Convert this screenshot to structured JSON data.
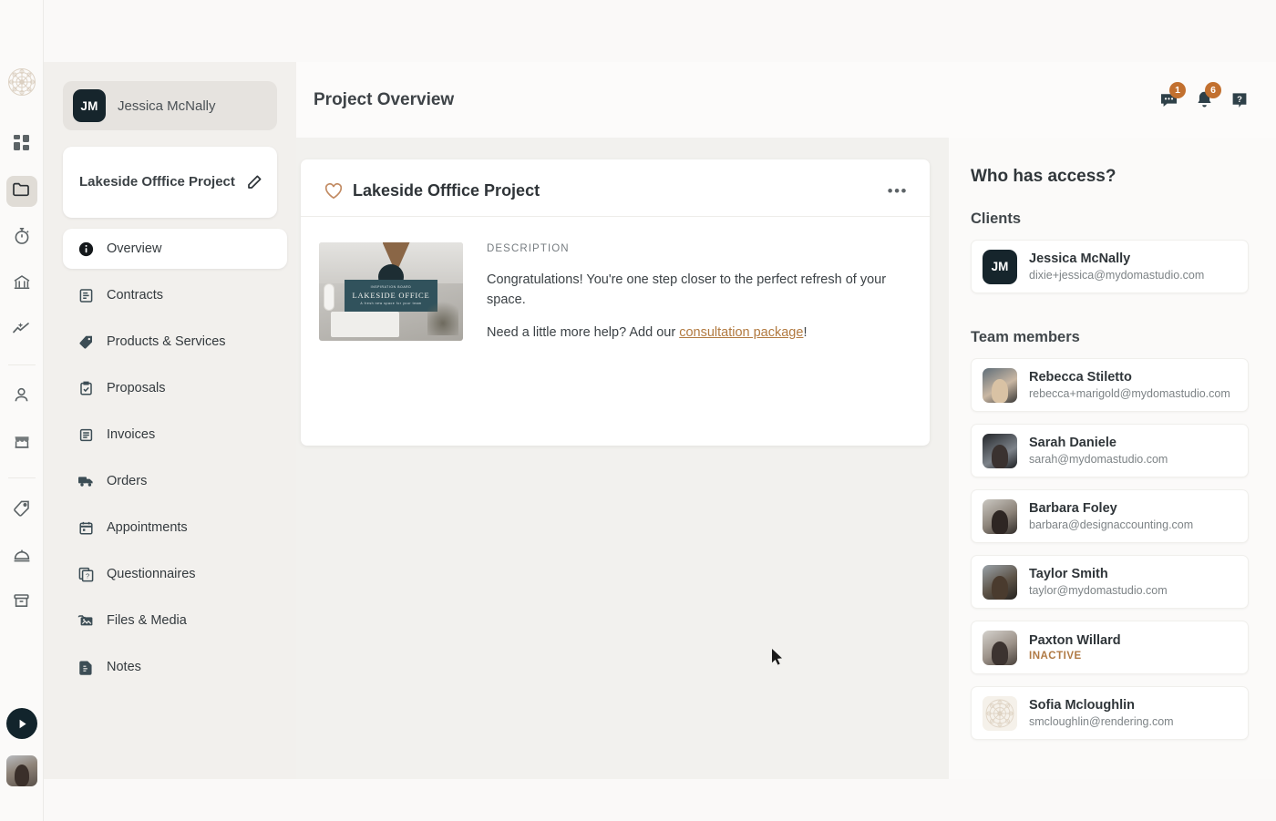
{
  "rail": {
    "logo_icon": "mandala-logo-icon",
    "items": [
      {
        "name": "dashboard",
        "icon": "grid-icon",
        "active": false
      },
      {
        "name": "projects",
        "icon": "folder-icon",
        "active": true
      },
      {
        "name": "time-tracking",
        "icon": "stopwatch-icon",
        "active": false
      },
      {
        "name": "bank",
        "icon": "bank-icon",
        "active": false
      },
      {
        "name": "reports",
        "icon": "chart-line-icon",
        "active": false
      },
      {
        "name": "contacts",
        "icon": "person-icon",
        "active": false
      },
      {
        "name": "storefront",
        "icon": "storefront-icon",
        "active": false
      },
      {
        "name": "pricing",
        "icon": "tag-icon",
        "active": false
      },
      {
        "name": "services",
        "icon": "service-bell-icon",
        "active": false
      },
      {
        "name": "archive",
        "icon": "archive-box-icon",
        "active": false
      }
    ],
    "play_icon": "play-button-icon",
    "avatar_icon": "user-avatar"
  },
  "sidebar": {
    "user": {
      "initials": "JM",
      "name": "Jessica McNally"
    },
    "project": {
      "title": "Lakeside Offfice Project",
      "edit_icon": "pencil-icon"
    },
    "nav": [
      {
        "label": "Overview",
        "icon": "info-circle-icon",
        "active": true
      },
      {
        "label": "Contracts",
        "icon": "contract-icon",
        "active": false
      },
      {
        "label": "Products & Services",
        "icon": "tag-icon",
        "active": false
      },
      {
        "label": "Proposals",
        "icon": "clipboard-check-icon",
        "active": false
      },
      {
        "label": "Invoices",
        "icon": "invoice-icon",
        "active": false
      },
      {
        "label": "Orders",
        "icon": "truck-icon",
        "active": false
      },
      {
        "label": "Appointments",
        "icon": "calendar-icon",
        "active": false
      },
      {
        "label": "Questionnaires",
        "icon": "question-doc-icon",
        "active": false
      },
      {
        "label": "Files & Media",
        "icon": "photo-folder-icon",
        "active": false
      },
      {
        "label": "Notes",
        "icon": "note-icon",
        "active": false
      }
    ]
  },
  "header": {
    "title": "Project Overview",
    "icons": [
      {
        "name": "messages-icon",
        "badge": "1"
      },
      {
        "name": "notifications-bell-icon",
        "badge": "6"
      },
      {
        "name": "help-question-icon",
        "badge": ""
      }
    ],
    "badge_color": "#c2702f"
  },
  "card": {
    "favorite_icon": "heart-outline-icon",
    "title": "Lakeside Offfice Project",
    "menu_icon": "ellipsis-icon",
    "menu_label": "•••",
    "description_label": "DESCRIPTION",
    "thumbnail": {
      "overline": "INSPIRATION BOARD",
      "headline": "LAKESIDE OFFICE",
      "subline": "A fresh new space for your team"
    },
    "paragraph1": "Congratulations! You're one step closer to the perfect refresh of your space.",
    "paragraph2_before": "Need a little more help? Add our ",
    "paragraph2_link": "consultation package",
    "paragraph2_after": "!",
    "link_color": "#b1793f"
  },
  "access": {
    "heading": "Who has access?",
    "clients_heading": "Clients",
    "clients": [
      {
        "initials": "JM",
        "name": "Jessica McNally",
        "email": "dixie+jessica@mydomastudio.com",
        "avatar": "initials"
      }
    ],
    "team_heading": "Team members",
    "team": [
      {
        "name": "Rebecca Stiletto",
        "email": "rebecca+marigold@mydomastudio.com",
        "avatar": "photo-rebecca",
        "inactive": false
      },
      {
        "name": "Sarah Daniele",
        "email": "sarah@mydomastudio.com",
        "avatar": "photo-sarah",
        "inactive": false
      },
      {
        "name": "Barbara Foley",
        "email": "barbara@designaccounting.com",
        "avatar": "photo-barbara",
        "inactive": false
      },
      {
        "name": "Taylor Smith",
        "email": "taylor@mydomastudio.com",
        "avatar": "photo-taylor",
        "inactive": false
      },
      {
        "name": "Paxton Willard",
        "email": "INACTIVE",
        "avatar": "photo-paxton",
        "inactive": true
      },
      {
        "name": "Sofia Mcloughlin",
        "email": "smcloughlin@rendering.com",
        "avatar": "photo-sofia",
        "inactive": false
      }
    ],
    "inactive_color": "#b07a45"
  }
}
